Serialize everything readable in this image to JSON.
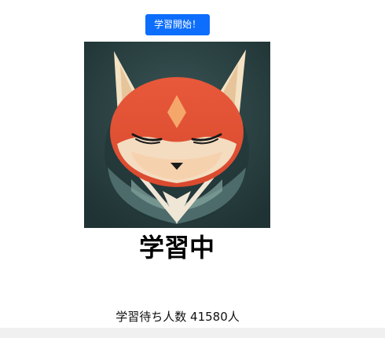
{
  "start_button": {
    "label": "学習開始！"
  },
  "image": {
    "icon": "fox-icon"
  },
  "status": {
    "text": "学習中"
  },
  "queue": {
    "label": "学習待ち人数",
    "count": "41580",
    "unit": "人"
  },
  "colors": {
    "button_bg": "#0d6efd",
    "button_text": "#ffffff",
    "image_bg": "#2e4648",
    "fox_orange": "#e05a3c",
    "fox_cream": "#f4dcc0",
    "footer_bg": "#f0f0f0"
  }
}
